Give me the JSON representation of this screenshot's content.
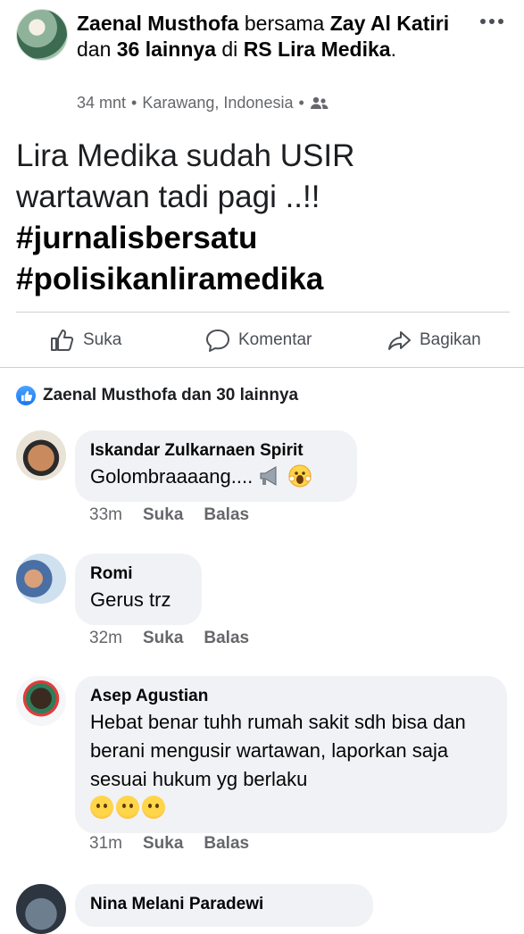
{
  "post": {
    "author": "Zaenal Musthofa",
    "with_word": "bersama",
    "tagged": "Zay Al Katiri",
    "and_word": "dan",
    "others": "36 lainnya",
    "at_word": "di",
    "location_name": "RS Lira Medika",
    "time": "34 mnt",
    "place": "Karawang, Indonesia",
    "text_line1": "Lira Medika sudah USIR",
    "text_line2": "wartawan tadi pagi ..!!",
    "hashtag1": "#jurnalisbersatu",
    "hashtag2": "#polisikanliramedika"
  },
  "actions": {
    "like": "Suka",
    "comment": "Komentar",
    "share": "Bagikan"
  },
  "reactions": {
    "summary": "Zaenal Musthofa dan 30 lainnya"
  },
  "comments": [
    {
      "name": "Iskandar Zulkarnaen Spirit",
      "text": "Golombraaaang....",
      "time": "33m",
      "like": "Suka",
      "reply": "Balas"
    },
    {
      "name": "Romi",
      "text": "Gerus trz",
      "time": "32m",
      "like": "Suka",
      "reply": "Balas"
    },
    {
      "name": "Asep Agustian",
      "text": "Hebat benar tuhh rumah sakit sdh bisa dan berani mengusir wartawan, laporkan saja sesuai hukum yg berlaku",
      "time": "31m",
      "like": "Suka",
      "reply": "Balas"
    },
    {
      "name": "Nina Melani Paradewi"
    }
  ],
  "colors": {
    "accent": "#1877f2",
    "secondary_text": "#65676b",
    "bubble": "#f0f2f5"
  }
}
